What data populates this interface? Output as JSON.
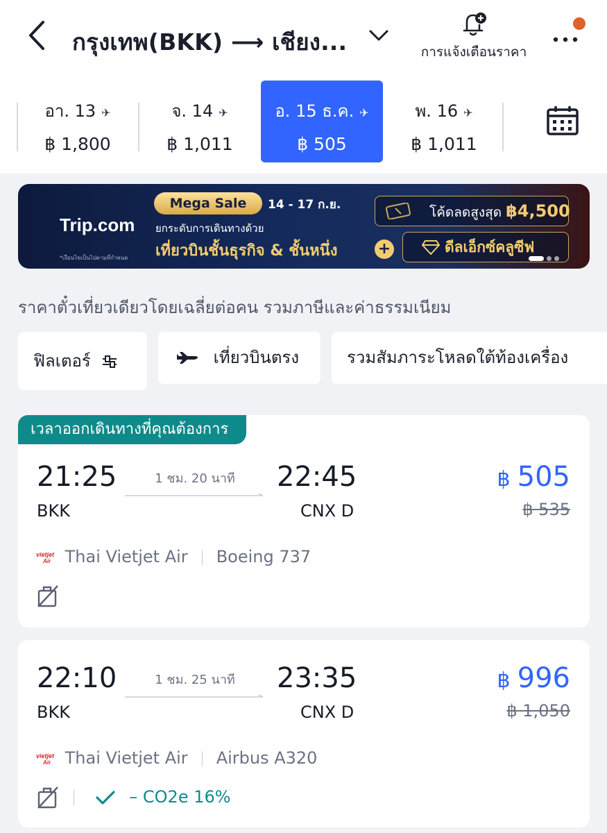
{
  "header": {
    "route_title": "กรุงเทพ(BKK) ⟶ เชียง...",
    "price_alert_label": "การแจ้งเตือนราคา"
  },
  "dates": [
    {
      "label": "อา. 13",
      "price": "฿ 1,800",
      "selected": false
    },
    {
      "label": "จ. 14",
      "price": "฿ 1,011",
      "selected": false
    },
    {
      "label": "อ. 15 ธ.ค.",
      "price": "฿ 505",
      "selected": true
    },
    {
      "label": "พ. 16",
      "price": "฿ 1,011",
      "selected": false
    }
  ],
  "banner": {
    "brand": "Trip.com",
    "note": "*เงื่อนไขเป็นไปตามที่กำหนด",
    "badge": "Mega Sale",
    "date_range": "14 - 17 ก.ย.",
    "line1": "ยกระดับการเดินทางด้วย",
    "line2": "เที่ยวบินชั้นธุรกิจ & ชั้นหนึ่ง",
    "plus": "+",
    "coupon_label": "โค้ดลดสูงสุด",
    "coupon_amount": "฿4,500",
    "deal_label": "ดีลเอ็กซ์คลูซีฟ"
  },
  "info_text": "ราคาตั๋วเที่ยวเดียวโดยเฉลี่ยต่อคน รวมภาษีและค่าธรรมเนียม",
  "filters": {
    "filter_label": "ฟิลเตอร์",
    "direct_label": "เที่ยวบินตรง",
    "baggage_label": "รวมสัมภาระโหลดใต้ท้องเครื่อง"
  },
  "flights": [
    {
      "tag": "เวลาออกเดินทางที่คุณต้องการ",
      "depart_time": "21:25",
      "arrive_time": "22:45",
      "duration": "1 ชม. 20 นาที",
      "from": "BKK",
      "to": "CNX D",
      "currency": "฿",
      "price": "505",
      "old_price": "฿ 535",
      "airline": "Thai Vietjet Air",
      "aircraft": "Boeing 737"
    },
    {
      "depart_time": "22:10",
      "arrive_time": "23:35",
      "duration": "1 ชม. 25 นาที",
      "from": "BKK",
      "to": "CNX D",
      "currency": "฿",
      "price": "996",
      "old_price": "฿ 1,050",
      "airline": "Thai Vietjet Air",
      "aircraft": "Airbus A320",
      "co2": "– CO2e 16%"
    }
  ],
  "colors": {
    "accent": "#3264ff",
    "tag": "#0f8a8a",
    "notification_dot": "#e0612a"
  }
}
